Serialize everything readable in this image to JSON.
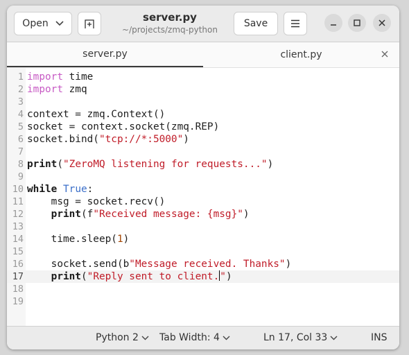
{
  "header": {
    "open_label": "Open",
    "save_label": "Save",
    "title": "server.py",
    "subtitle": "~/projects/zmq-python"
  },
  "tabs": [
    {
      "label": "server.py",
      "active": true
    },
    {
      "label": "client.py",
      "active": false
    }
  ],
  "editor": {
    "current_line": 17,
    "lines": [
      {
        "n": "1",
        "code": "import time"
      },
      {
        "n": "2",
        "code": "import zmq"
      },
      {
        "n": "3",
        "code": ""
      },
      {
        "n": "4",
        "code": "context = zmq.Context()"
      },
      {
        "n": "5",
        "code": "socket = context.socket(zmq.REP)"
      },
      {
        "n": "6",
        "code": "socket.bind(\"tcp://*:5000\")"
      },
      {
        "n": "7",
        "code": ""
      },
      {
        "n": "8",
        "code": "print(\"ZeroMQ listening for requests...\")"
      },
      {
        "n": "9",
        "code": ""
      },
      {
        "n": "10",
        "code": "while True:"
      },
      {
        "n": "11",
        "code": "    msg = socket.recv()"
      },
      {
        "n": "12",
        "code": "    print(f\"Received message: {msg}\")"
      },
      {
        "n": "13",
        "code": ""
      },
      {
        "n": "14",
        "code": "    time.sleep(1)"
      },
      {
        "n": "15",
        "code": ""
      },
      {
        "n": "16",
        "code": "    socket.send(b\"Message received. Thanks\")"
      },
      {
        "n": "17",
        "code": "    print(\"Reply sent to client.\")"
      },
      {
        "n": "18",
        "code": ""
      },
      {
        "n": "19",
        "code": ""
      }
    ]
  },
  "statusbar": {
    "language": "Python 2",
    "tab_width": "Tab Width: 4",
    "position": "Ln 17, Col 33",
    "mode": "INS"
  },
  "icons": {
    "open_dropdown": "chevron-down-icon",
    "new_tab": "new-tab-icon",
    "menu": "hamburger-icon",
    "minimize": "minimize-icon",
    "maximize": "maximize-icon",
    "close": "close-icon"
  },
  "colors": {
    "import_keyword": "#c75ac4",
    "string": "#c01c28",
    "number": "#a24400",
    "builtin_constant": "#3b6fc9"
  }
}
